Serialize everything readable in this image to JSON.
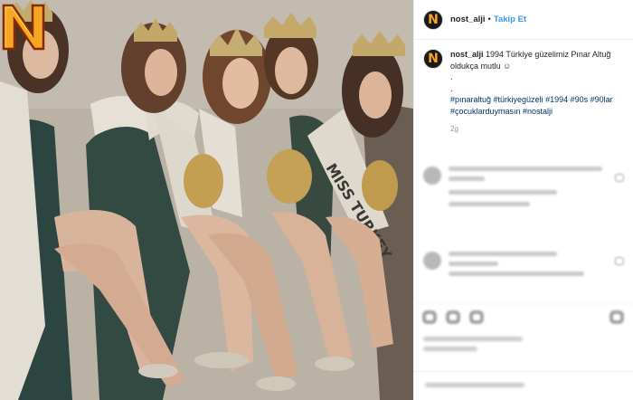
{
  "post": {
    "username": "nost_alji",
    "separator": "•",
    "follow_label": "Takip Et",
    "avatar_letter": "N",
    "caption_username": "nost_alji",
    "caption_text": "1994 Türkiye güzelimiz Pınar Altuğ oldukça mutlu ☺",
    "caption_dots": [
      ".",
      "."
    ],
    "hashtags": "#pınaraltuğ #türkiyegüzeli #1994 #90s #90lar #çocuklarduymasın #nostalji",
    "timestamp": "2g",
    "sash_text": "MISS TURKEY",
    "watermark_letter": "N"
  },
  "colors": {
    "brand_orange": "#f5a623",
    "follow_blue": "#3897f0",
    "hashtag_blue": "#003569"
  },
  "icons": [
    "heart-icon",
    "comment-icon",
    "share-icon",
    "bookmark-icon"
  ]
}
